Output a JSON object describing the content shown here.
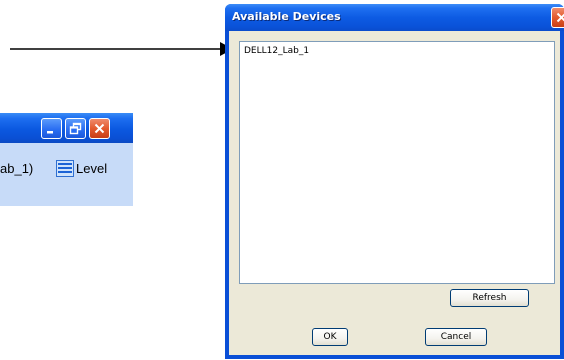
{
  "dialog": {
    "title": "Available Devices",
    "devices": [
      "DELL12_Lab_1"
    ],
    "refresh_label": "Refresh",
    "ok_label": "OK",
    "cancel_label": "Cancel"
  },
  "left_window": {
    "partial_text": "ab_1)",
    "level_label": "Level"
  },
  "colors": {
    "titlebar_blue": "#0a52d8",
    "dialog_face": "#ece9d8",
    "close_red": "#e35a2e",
    "content_bg": "#c7dbf8"
  },
  "icons": {
    "arrow": "right-arrow-icon",
    "level": "list-lines-icon",
    "minimize": "minimize-icon",
    "restore": "restore-icon",
    "close": "close-icon"
  }
}
